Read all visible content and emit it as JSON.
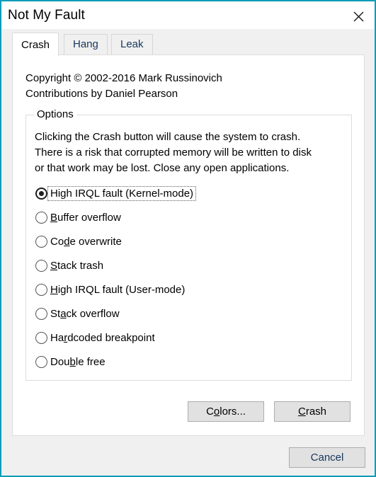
{
  "window": {
    "title": "Not My Fault",
    "close_icon": "close-icon",
    "accent_color": "#0d9cb8",
    "titlebar_background": "#ffffff",
    "dialog_background": "#f0f0f0"
  },
  "tabs": [
    {
      "label": "Crash",
      "active": true
    },
    {
      "label": "Hang",
      "active": false
    },
    {
      "label": "Leak",
      "active": false
    }
  ],
  "panel": {
    "copyright_line1": "Copyright © 2002-2016 Mark Russinovich",
    "copyright_line2": "Contributions by Daniel Pearson"
  },
  "options": {
    "legend": "Options",
    "description_line1": "Clicking the Crash button will cause the system to crash.",
    "description_line2": "There is a risk that corrupted memory will be written to disk",
    "description_line3": "or that work may be lost. Close any open applications.",
    "radios": [
      {
        "label": "High IRQL fault (Kernel-mode)",
        "pre": "Hi",
        "mnemonic": "g",
        "post": "h IRQL fault (Kernel-mode)",
        "checked": true,
        "focused": true
      },
      {
        "label": "Buffer overflow",
        "pre": "",
        "mnemonic": "B",
        "post": "uffer overflow",
        "checked": false,
        "focused": false
      },
      {
        "label": "Code overwrite",
        "pre": "Co",
        "mnemonic": "d",
        "post": "e overwrite",
        "checked": false,
        "focused": false
      },
      {
        "label": "Stack trash",
        "pre": "",
        "mnemonic": "S",
        "post": "tack trash",
        "checked": false,
        "focused": false
      },
      {
        "label": "High IRQL fault (User-mode)",
        "pre": "",
        "mnemonic": "H",
        "post": "igh IRQL fault (User-mode)",
        "checked": false,
        "focused": false
      },
      {
        "label": "Stack overflow",
        "pre": "St",
        "mnemonic": "a",
        "post": "ck overflow",
        "checked": false,
        "focused": false
      },
      {
        "label": "Hardcoded breakpoint",
        "pre": "Ha",
        "mnemonic": "r",
        "post": "dcoded breakpoint",
        "checked": false,
        "focused": false
      },
      {
        "label": "Double free",
        "pre": "Dou",
        "mnemonic": "b",
        "post": "le free",
        "checked": false,
        "focused": false
      }
    ]
  },
  "buttons": {
    "colors": {
      "label": "Colors...",
      "pre": "C",
      "mnemonic": "o",
      "post": "lors..."
    },
    "crash": {
      "label": "Crash",
      "pre": "",
      "mnemonic": "C",
      "post": "rash"
    },
    "cancel": {
      "label": "Cancel"
    }
  }
}
